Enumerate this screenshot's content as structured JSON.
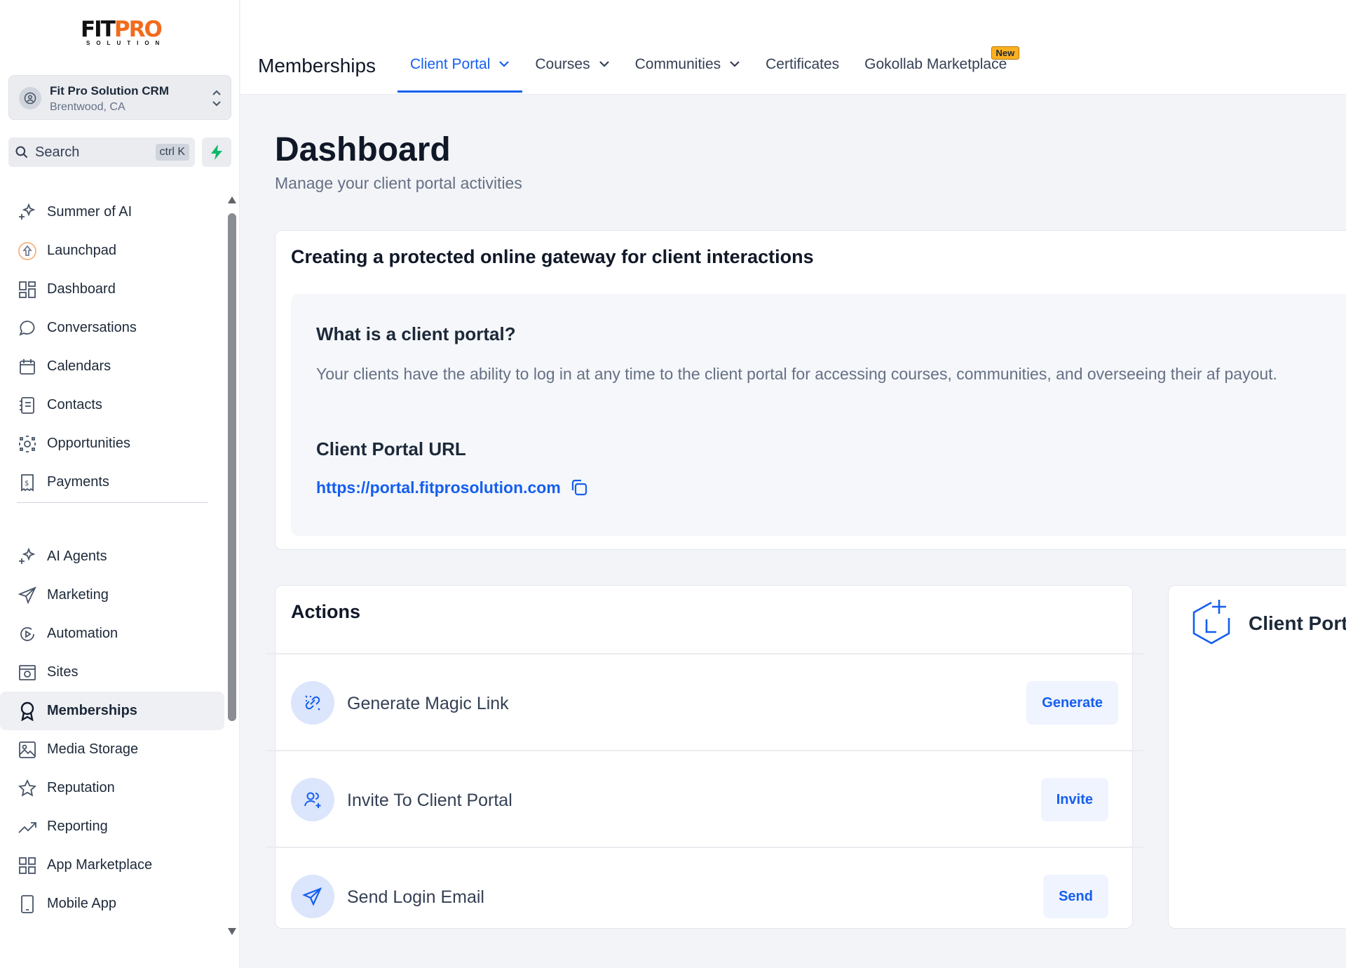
{
  "brand": {
    "logo_fit": "FIT",
    "logo_pro": "PRO",
    "logo_sub": "SOLUTION"
  },
  "account": {
    "name": "Fit Pro Solution CRM",
    "location": "Brentwood, CA"
  },
  "search": {
    "label": "Search",
    "shortcut": "ctrl K"
  },
  "sidebar": {
    "items_top": [
      {
        "label": "Summer of AI",
        "icon": "sparkle-icon"
      },
      {
        "label": "Launchpad",
        "icon": "rocket-icon"
      },
      {
        "label": "Dashboard",
        "icon": "grid-icon"
      },
      {
        "label": "Conversations",
        "icon": "chat-icon"
      },
      {
        "label": "Calendars",
        "icon": "calendar-icon"
      },
      {
        "label": "Contacts",
        "icon": "contacts-icon"
      },
      {
        "label": "Opportunities",
        "icon": "opportunities-icon"
      },
      {
        "label": "Payments",
        "icon": "payments-icon"
      }
    ],
    "items_bottom": [
      {
        "label": "AI Agents",
        "icon": "sparkle-icon"
      },
      {
        "label": "Marketing",
        "icon": "send-icon"
      },
      {
        "label": "Automation",
        "icon": "automation-icon"
      },
      {
        "label": "Sites",
        "icon": "sites-icon"
      },
      {
        "label": "Memberships",
        "icon": "award-icon",
        "active": true
      },
      {
        "label": "Media Storage",
        "icon": "image-icon"
      },
      {
        "label": "Reputation",
        "icon": "star-icon"
      },
      {
        "label": "Reporting",
        "icon": "trend-icon"
      },
      {
        "label": "App Marketplace",
        "icon": "grid-icon"
      },
      {
        "label": "Mobile App",
        "icon": "mobile-icon"
      }
    ]
  },
  "topbar": {
    "title": "Memberships",
    "tabs": [
      {
        "label": "Client Portal",
        "active": true,
        "dropdown": true
      },
      {
        "label": "Courses",
        "dropdown": true
      },
      {
        "label": "Communities",
        "dropdown": true
      },
      {
        "label": "Certificates",
        "dropdown": false
      },
      {
        "label": "Gokollab Marketplace",
        "dropdown": false,
        "badge": "New"
      }
    ]
  },
  "main": {
    "title": "Dashboard",
    "subtitle": "Manage your client portal activities",
    "gateway": {
      "heading": "Creating a protected online gateway for client interactions",
      "question": "What is a client portal?",
      "description": "Your clients have the ability to log in at any time to the client portal for accessing courses, communities, and overseeing their af payout.",
      "url_heading": "Client Portal URL",
      "url": "https://portal.fitprosolution.com"
    },
    "actions": {
      "heading": "Actions",
      "rows": [
        {
          "label": "Generate Magic Link",
          "button": "Generate",
          "icon": "magic-link-icon"
        },
        {
          "label": "Invite To Client Portal",
          "button": "Invite",
          "icon": "invite-user-icon"
        },
        {
          "label": "Send Login Email",
          "button": "Send",
          "icon": "send-icon"
        }
      ]
    },
    "side_card": {
      "title": "Client Port"
    }
  },
  "colors": {
    "accent": "#155eef",
    "brand_orange": "#f26b1d",
    "active_bg": "#eef0f3",
    "badge": "#fdb022",
    "bolt": "#12b76a"
  }
}
